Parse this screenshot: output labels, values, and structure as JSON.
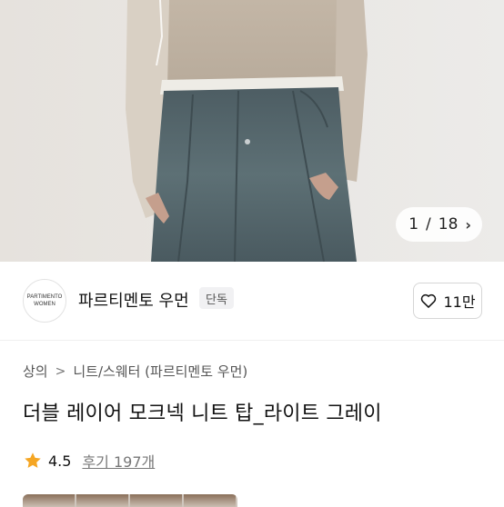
{
  "gallery": {
    "current": "1",
    "total": "18",
    "separator": "/"
  },
  "brand": {
    "logo_line1": "PARTIMENTO",
    "logo_line2": "WOMEN",
    "name": "파르티멘토 우먼",
    "badge": "단독",
    "like_count": "11만",
    "like_icon": "heart-outline-icon"
  },
  "breadcrumb": {
    "items": [
      "상의",
      "니트/스웨터 (파르티멘토 우먼)"
    ],
    "separator_icon": "chevron-right-icon"
  },
  "product": {
    "title": "더블 레이어 모크넥 니트 탑_라이트 그레이",
    "rating": "4.5",
    "reviews_label": "후기 197개"
  },
  "colors": {
    "star": "#f5a623",
    "heart": "#111111"
  }
}
